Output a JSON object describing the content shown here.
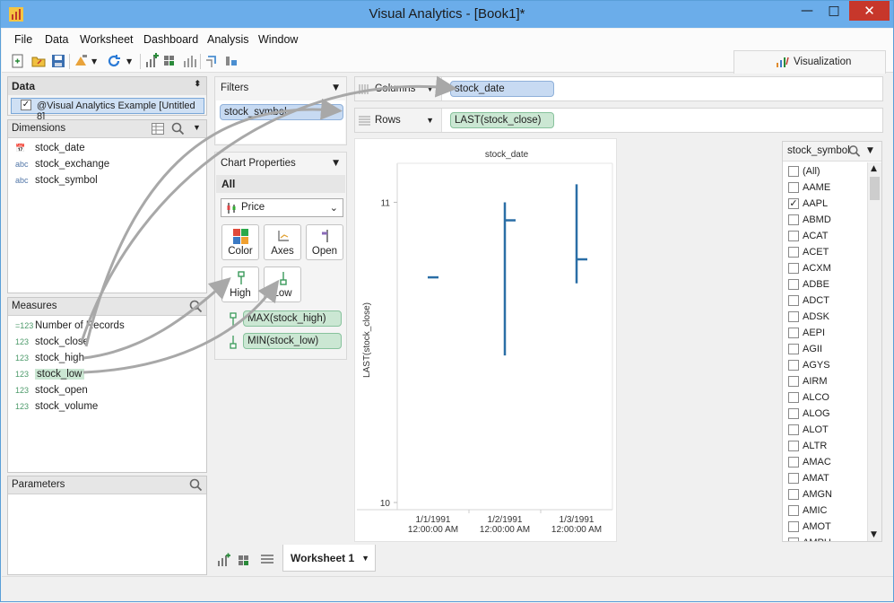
{
  "window": {
    "title": "Visual Analytics - [Book1]*",
    "minimize": "—",
    "maximize": "□",
    "close": "✕"
  },
  "menu": [
    "File",
    "Data",
    "Worksheet",
    "Dashboard",
    "Analysis",
    "Window"
  ],
  "visualization_tab": {
    "label": "Visualization"
  },
  "data_panel": {
    "header": "Data",
    "datasource": "@Visual Analytics Example [Untitled 8]",
    "dimensions_label": "Dimensions",
    "dimensions": [
      {
        "type": "date",
        "name": "stock_date"
      },
      {
        "type": "abc",
        "name": "stock_exchange"
      },
      {
        "type": "abc",
        "name": "stock_symbol"
      }
    ],
    "measures_label": "Measures",
    "measures": [
      {
        "type": "=123",
        "name": "Number of Records"
      },
      {
        "type": "123",
        "name": "stock_close"
      },
      {
        "type": "123",
        "name": "stock_high"
      },
      {
        "type": "123",
        "name": "stock_low"
      },
      {
        "type": "123",
        "name": "stock_open"
      },
      {
        "type": "123",
        "name": "stock_volume"
      }
    ],
    "parameters_label": "Parameters"
  },
  "filters": {
    "header": "Filters",
    "pill": "stock_symbol"
  },
  "chart_properties": {
    "header": "Chart Properties",
    "all_label": "All",
    "mark_type": "Price",
    "buttons": [
      "Color",
      "Axes",
      "Open",
      "High",
      "Low"
    ],
    "high_pill": "MAX(stock_high)",
    "low_pill": "MIN(stock_low)"
  },
  "shelves": {
    "columns_label": "Columns",
    "columns_pill": "stock_date",
    "rows_label": "Rows",
    "rows_pill": "LAST(stock_close)"
  },
  "chart_data": {
    "type": "bar",
    "title": "stock_date",
    "ylabel": "LAST(stock_close)",
    "ylim": [
      10,
      11.1
    ],
    "yticks": [
      10,
      11
    ],
    "categories": [
      "1/1/1991 12:00:00 AM",
      "1/2/1991 12:00:00 AM",
      "1/3/1991 12:00:00 AM"
    ],
    "category_lines": [
      [
        "1/1/1991",
        "12:00:00 AM"
      ],
      [
        "1/2/1991",
        "12:00:00 AM"
      ],
      [
        "1/3/1991",
        "12:00:00 AM"
      ]
    ],
    "series": [
      {
        "name": "high",
        "values": [
          10.75,
          11.0,
          11.06
        ]
      },
      {
        "name": "low",
        "values": [
          10.75,
          10.49,
          10.73
        ]
      },
      {
        "name": "close",
        "values": [
          10.75,
          10.94,
          10.81
        ]
      }
    ],
    "color": "#2a6ea6"
  },
  "symbol_filter": {
    "header": "stock_symbol",
    "items": [
      {
        "label": "(All)",
        "checked": false
      },
      {
        "label": "AAME",
        "checked": false
      },
      {
        "label": "AAPL",
        "checked": true
      },
      {
        "label": "ABMD",
        "checked": false
      },
      {
        "label": "ACAT",
        "checked": false
      },
      {
        "label": "ACET",
        "checked": false
      },
      {
        "label": "ACXM",
        "checked": false
      },
      {
        "label": "ADBE",
        "checked": false
      },
      {
        "label": "ADCT",
        "checked": false
      },
      {
        "label": "ADSK",
        "checked": false
      },
      {
        "label": "AEPI",
        "checked": false
      },
      {
        "label": "AGII",
        "checked": false
      },
      {
        "label": "AGYS",
        "checked": false
      },
      {
        "label": "AIRM",
        "checked": false
      },
      {
        "label": "ALCO",
        "checked": false
      },
      {
        "label": "ALOG",
        "checked": false
      },
      {
        "label": "ALOT",
        "checked": false
      },
      {
        "label": "ALTR",
        "checked": false
      },
      {
        "label": "AMAC",
        "checked": false
      },
      {
        "label": "AMAT",
        "checked": false
      },
      {
        "label": "AMGN",
        "checked": false
      },
      {
        "label": "AMIC",
        "checked": false
      },
      {
        "label": "AMOT",
        "checked": false
      },
      {
        "label": "AMPH",
        "checked": false
      }
    ]
  },
  "worksheet_tab": {
    "label": "Worksheet 1"
  }
}
